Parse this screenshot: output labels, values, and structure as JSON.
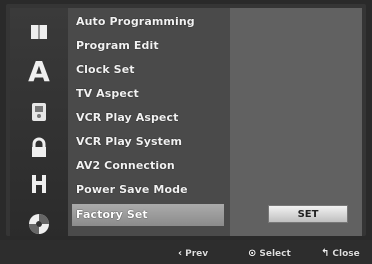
{
  "sidebar": {
    "letter_icon": "A",
    "icons": [
      {
        "name": "book-icon"
      },
      {
        "name": "language-icon"
      },
      {
        "name": "display-icon"
      },
      {
        "name": "lock-icon"
      },
      {
        "name": "film-icon"
      },
      {
        "name": "disc-icon"
      }
    ]
  },
  "menu": {
    "items": [
      {
        "label": "Auto Programming"
      },
      {
        "label": "Program Edit"
      },
      {
        "label": "Clock Set"
      },
      {
        "label": "TV Aspect"
      },
      {
        "label": "VCR Play Aspect"
      },
      {
        "label": "VCR Play System"
      },
      {
        "label": "AV2 Connection"
      },
      {
        "label": "Power Save Mode"
      },
      {
        "label": "Factory Set"
      }
    ],
    "selected_index": 8
  },
  "action": {
    "set_label": "SET"
  },
  "footer": {
    "prev_label": "Prev",
    "select_label": "Select",
    "close_label": "Close"
  },
  "colors": {
    "menu_background": "#4a4a4a",
    "selected_background": "#9a9a9a",
    "right_panel": "#616161",
    "set_button": "#d8d8d8",
    "text": "#f2f2f2"
  }
}
